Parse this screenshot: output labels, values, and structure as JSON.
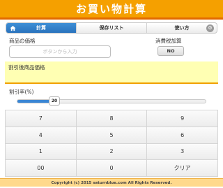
{
  "header": {
    "title": "お買い物計算"
  },
  "tabs": [
    {
      "label": "計算",
      "icon": "home-icon",
      "active": true
    },
    {
      "label": "保存リスト",
      "active": false
    },
    {
      "label": "使い方",
      "icon": "gear-icon",
      "active": false
    }
  ],
  "price": {
    "label": "商品の価格",
    "placeholder": "ボタンから入力"
  },
  "tax": {
    "label": "消費税加算",
    "toggle": "NO"
  },
  "result": {
    "label": "割引後商品価格"
  },
  "discount": {
    "label": "割引率(%)",
    "value": "20",
    "max": 100
  },
  "keypad": {
    "keys": [
      "7",
      "8",
      "9",
      "4",
      "5",
      "6",
      "1",
      "2",
      "3",
      "00",
      "0",
      "クリア"
    ]
  },
  "footer": {
    "text": "Copyright (c) 2015 saturnblue.com All Rights Reserved."
  },
  "colors": {
    "header": "#f5a000",
    "accent": "#3a86d4",
    "result_bg": "#ffffb3"
  }
}
